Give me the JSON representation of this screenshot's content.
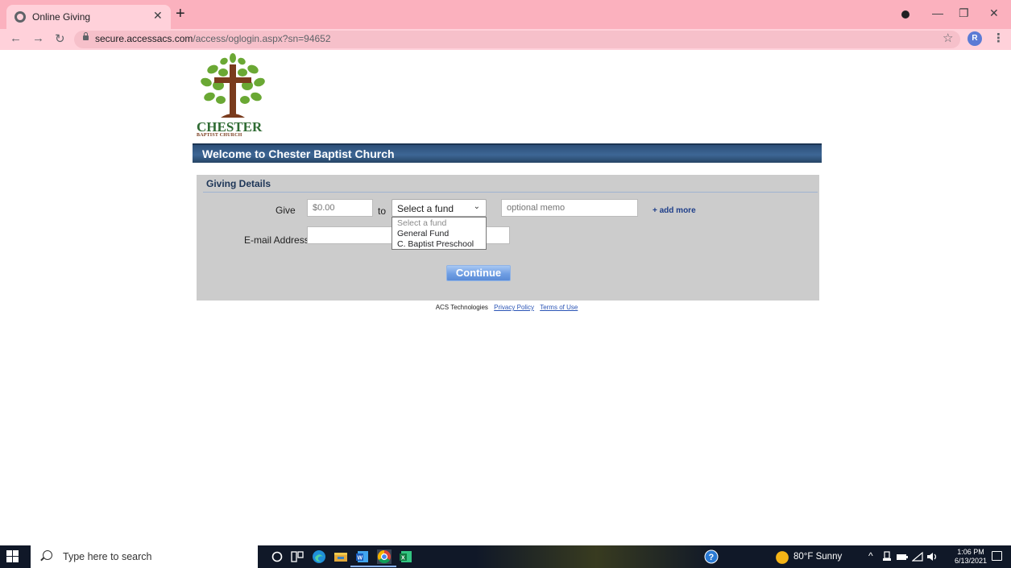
{
  "browser": {
    "tab_title": "Online Giving",
    "url_host": "secure.accessacs.com",
    "url_path": "/access/oglogin.aspx?sn=94652",
    "profile_initial": "R"
  },
  "page": {
    "logo_text": "CHESTER",
    "logo_subtext": "BAPTIST CHURCH",
    "welcome": "Welcome to Chester Baptist Church",
    "section_title": "Giving Details",
    "give_label": "Give",
    "amount_placeholder": "$0.00",
    "to_label": "to",
    "fund_select_value": "Select a fund",
    "fund_options": [
      "Select a fund",
      "General Fund",
      "C. Baptist Preschool"
    ],
    "memo_placeholder": "optional memo",
    "add_more": "+ add more",
    "email_label": "E-mail Address",
    "email_value": "",
    "continue_label": "Continue"
  },
  "footer": {
    "company": "ACS Technologies",
    "privacy": "Privacy Policy",
    "terms": "Terms of Use"
  },
  "taskbar": {
    "search_placeholder": "Type here to search",
    "weather": "80°F  Sunny",
    "time": "1:06 PM",
    "date": "6/13/2021"
  },
  "colors": {
    "tab_strip": "#fbb1be",
    "welcome_bar": "#2d4f78",
    "panel": "#cccccc",
    "continue_button": "#6f9ee3"
  }
}
